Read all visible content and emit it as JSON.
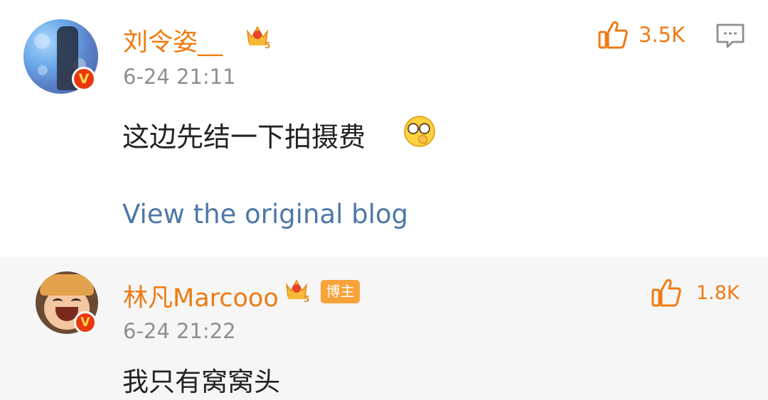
{
  "comment": {
    "username": "刘令姿__",
    "time": "6-24 21:11",
    "like_count": "3.5K",
    "text": "这边先结一下拍摄费",
    "emoji": "facepalm-emoji",
    "view_original": "View the original blog",
    "verified_badge": "V",
    "member_level": "5"
  },
  "reply": {
    "username": "林凡Marcooo",
    "host_tag": "博主",
    "time": "6-24 21:22",
    "like_count": "1.8K",
    "text": "我只有窝窝头",
    "verified_badge": "V",
    "member_level": "5"
  },
  "colors": {
    "username": "#ef7b12",
    "time": "#8f8f8f",
    "link": "#4d78a8",
    "host_tag_bg": "#f8a23a",
    "verified_badge_bg": "#e9380e",
    "reply_bg": "#f6f6f6"
  },
  "icons": {
    "like": "thumbs-up-icon",
    "comment": "comment-bubble-icon",
    "crown": "crown-vip-icon",
    "verified": "verified-v-icon"
  }
}
